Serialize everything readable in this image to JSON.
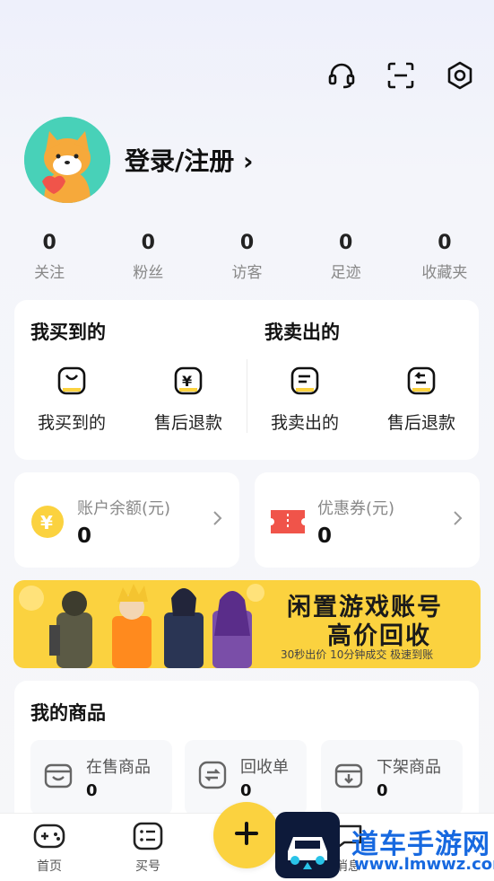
{
  "header": {
    "icons": [
      "headset-icon",
      "scan-icon",
      "settings-icon"
    ]
  },
  "profile": {
    "login_label": "登录/注册 ›"
  },
  "stats": [
    {
      "value": "0",
      "label": "关注"
    },
    {
      "value": "0",
      "label": "粉丝"
    },
    {
      "value": "0",
      "label": "访客"
    },
    {
      "value": "0",
      "label": "足迹"
    },
    {
      "value": "0",
      "label": "收藏夹"
    }
  ],
  "orders": {
    "bought_title": "我买到的",
    "sold_title": "我卖出的",
    "items": [
      {
        "label": "我买到的",
        "icon": "bag-icon"
      },
      {
        "label": "售后退款",
        "icon": "yuan-refund-icon"
      },
      {
        "label": "我卖出的",
        "icon": "sold-list-icon"
      },
      {
        "label": "售后退款",
        "icon": "return-icon"
      }
    ]
  },
  "wallet": {
    "balance_label": "账户余额(元)",
    "balance_value": "0",
    "coupon_label": "优惠券(元)",
    "coupon_value": "0"
  },
  "banner": {
    "line1": "闲置游戏账号",
    "line2": "高价回收",
    "sub": "30秒出价 10分钟成交 极速到账"
  },
  "goods": {
    "title": "我的商品",
    "items": [
      {
        "label": "在售商品",
        "value": "0"
      },
      {
        "label": "回收单",
        "value": "0"
      },
      {
        "label": "下架商品",
        "value": "0"
      }
    ]
  },
  "tabbar": {
    "items": [
      {
        "label": "首页"
      },
      {
        "label": "买号"
      },
      {
        "label": "消息"
      }
    ]
  },
  "watermark": {
    "text": "道车手游网",
    "url": "www.lmwwz.com"
  },
  "colors": {
    "accent": "#fbd23f",
    "avatar_bg": "#48d1b8",
    "coupon_red": "#f0544a"
  }
}
